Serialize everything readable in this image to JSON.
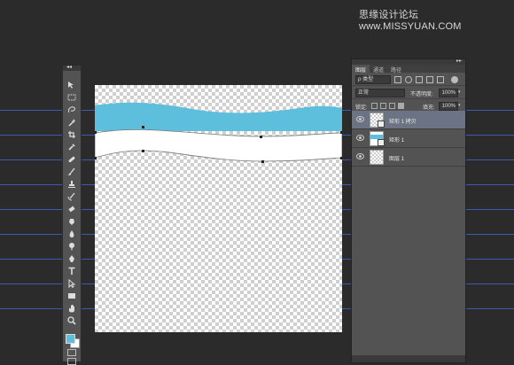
{
  "watermark": "思缘设计论坛 www.MISSYUAN.COM",
  "toolbar": {
    "collapse_label": "◂◂",
    "tools": [
      "move-tool",
      "marquee-tool",
      "lasso-tool",
      "magic-wand-tool",
      "crop-tool",
      "eyedropper-tool",
      "healing-brush-tool",
      "brush-tool",
      "clone-stamp-tool",
      "history-brush-tool",
      "eraser-tool",
      "gradient-tool",
      "blur-tool",
      "dodge-tool",
      "pen-tool",
      "type-tool",
      "path-selection-tool",
      "rectangle-tool",
      "hand-tool",
      "zoom-tool"
    ],
    "foreground_color": "#5ebfdc",
    "background_color": "#ffffff"
  },
  "canvas": {
    "wave_color": "#5ebfdc"
  },
  "layers_panel": {
    "header_label": "▸▸",
    "tabs": [
      "图层",
      "通道",
      "路径"
    ],
    "filter_kind": "ρ 类型",
    "blend_mode": "正常",
    "opacity_label": "不透明度:",
    "opacity_value": "100%",
    "lock_label": "锁定:",
    "fill_label": "填充:",
    "fill_value": "100%",
    "layers": [
      {
        "name": "矩形 1 拷贝",
        "selected": true
      },
      {
        "name": "矩形 1",
        "selected": false
      },
      {
        "name": "图层 1",
        "selected": false
      }
    ]
  }
}
